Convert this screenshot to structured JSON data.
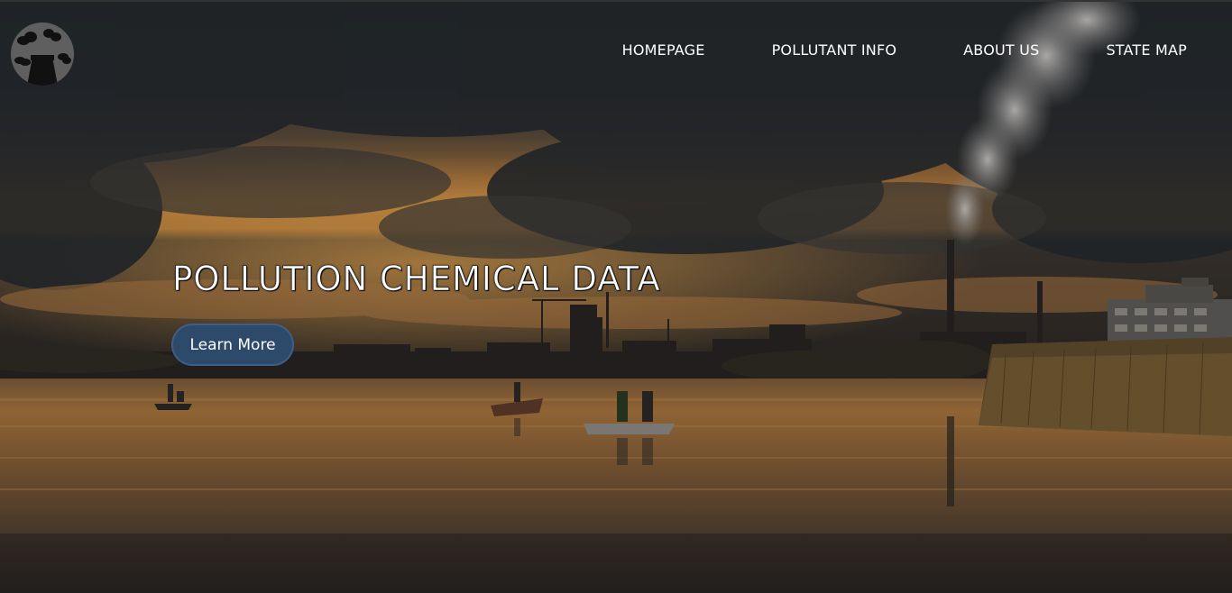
{
  "header": {
    "logo_icon": "factory-smoke-icon",
    "nav": [
      {
        "label": "HOMEPAGE"
      },
      {
        "label": "POLLUTANT INFO"
      },
      {
        "label": "ABOUT US"
      },
      {
        "label": "STATE MAP"
      }
    ]
  },
  "hero": {
    "title": "POLLUTION CHEMICAL DATA",
    "cta_label": "Learn More",
    "background": "industrial-lake-sunset-photo"
  },
  "colors": {
    "button_bg": "#2e4a6b",
    "nav_text": "#ffffff",
    "sky_glow": "#c98a3e",
    "cloud_dark": "#2a2d31"
  }
}
